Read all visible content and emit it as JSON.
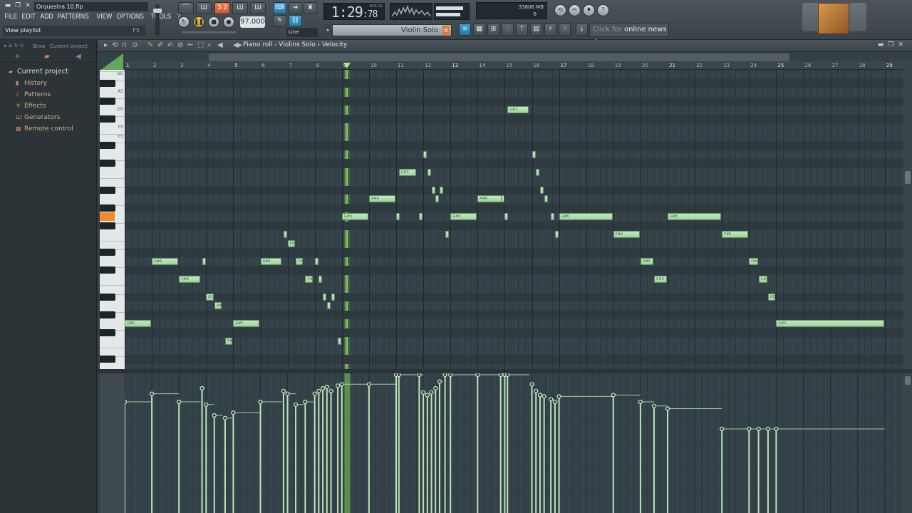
{
  "window": {
    "file_title": "Orquestra 10.flp",
    "menu": [
      "FILE",
      "EDIT",
      "ADD",
      "PATTERNS",
      "VIEW",
      "OPTIONS",
      "TOOLS",
      "?"
    ],
    "hint": "View playlist",
    "hint_key": "F5"
  },
  "transport": {
    "time_main": "1:29",
    "time_frac": ":78",
    "time_unit": "M:S:CS",
    "tempo": "97.000",
    "pattern_display": "3 2",
    "snap_mode": "Line",
    "memory": "33606 MB",
    "cpu": "6"
  },
  "channel": {
    "name": "Violin Solo",
    "number": "6"
  },
  "news": {
    "prefix": "Click for",
    "label": "online news"
  },
  "browser": {
    "label": "Brow",
    "sub": "Current project",
    "items": [
      {
        "label": "Current project",
        "icon": "folder-icon",
        "root": true
      },
      {
        "label": "History",
        "icon": "history-icon"
      },
      {
        "label": "Patterns",
        "icon": "pattern-icon"
      },
      {
        "label": "Effects",
        "icon": "effects-icon"
      },
      {
        "label": "Generators",
        "icon": "generator-icon"
      },
      {
        "label": "Remote control",
        "icon": "remote-icon"
      }
    ]
  },
  "piano_roll": {
    "breadcrumb": "Piano roll - Violins Solo › Velocity",
    "bars": [
      1,
      2,
      3,
      4,
      5,
      6,
      7,
      8,
      9,
      10,
      11,
      12,
      13,
      14,
      15,
      16,
      17,
      18,
      19,
      20,
      21,
      22,
      23,
      24,
      25,
      26,
      27,
      28,
      29
    ],
    "playhead_bar": 9.2,
    "highlighted_key": "G6",
    "key_labels": [
      "B7",
      "A7",
      "G7",
      "F7",
      "E7",
      "D7",
      "C7",
      "B6",
      "A6",
      "G6",
      "F6",
      "E6",
      "D6",
      "C6",
      "B5",
      "A5",
      "G5",
      "F5",
      "E5"
    ],
    "accent_color": "#9fd39e",
    "playhead_color": "#8ce65a"
  },
  "notes": [
    {
      "label": "G#5",
      "start": 1.0,
      "len": 1.0,
      "pitch": 55
    },
    {
      "label": "D#6",
      "start": 2.0,
      "len": 1.0,
      "pitch": 62
    },
    {
      "label": "C#6",
      "start": 3.0,
      "len": 0.8,
      "pitch": 60
    },
    {
      "label": "",
      "start": 3.85,
      "len": 0.1,
      "pitch": 62
    },
    {
      "label": "B5",
      "start": 4.0,
      "len": 0.3,
      "pitch": 58
    },
    {
      "label": "A#5",
      "start": 4.3,
      "len": 0.3,
      "pitch": 57
    },
    {
      "label": "F#5",
      "start": 4.7,
      "len": 0.3,
      "pitch": 53
    },
    {
      "label": "G#5",
      "start": 5.0,
      "len": 1.0,
      "pitch": 55
    },
    {
      "label": "D#6",
      "start": 6.0,
      "len": 0.8,
      "pitch": 62
    },
    {
      "label": "",
      "start": 6.85,
      "len": 0.1,
      "pitch": 65
    },
    {
      "label": "F6",
      "start": 7.0,
      "len": 0.3,
      "pitch": 64
    },
    {
      "label": "D#6",
      "start": 7.3,
      "len": 0.3,
      "pitch": 62
    },
    {
      "label": "C#6",
      "start": 7.65,
      "len": 0.3,
      "pitch": 60
    },
    {
      "label": "",
      "start": 8.0,
      "len": 0.1,
      "pitch": 62
    },
    {
      "label": "",
      "start": 8.15,
      "len": 0.1,
      "pitch": 60
    },
    {
      "label": "",
      "start": 8.3,
      "len": 0.1,
      "pitch": 58
    },
    {
      "label": "",
      "start": 8.45,
      "len": 0.1,
      "pitch": 57
    },
    {
      "label": "",
      "start": 8.6,
      "len": 0.1,
      "pitch": 58
    },
    {
      "label": "",
      "start": 8.85,
      "len": 0.1,
      "pitch": 53
    },
    {
      "label": "G#6",
      "start": 9.0,
      "len": 1.0,
      "pitch": 67
    },
    {
      "label": "A#6",
      "start": 10.0,
      "len": 1.0,
      "pitch": 69
    },
    {
      "label": "",
      "start": 11.0,
      "len": 0.15,
      "pitch": 67
    },
    {
      "label": "C#7",
      "start": 11.1,
      "len": 0.65,
      "pitch": 72
    },
    {
      "label": "",
      "start": 11.85,
      "len": 0.15,
      "pitch": 67
    },
    {
      "label": "",
      "start": 12.0,
      "len": 0.1,
      "pitch": 74
    },
    {
      "label": "",
      "start": 12.15,
      "len": 0.1,
      "pitch": 72
    },
    {
      "label": "",
      "start": 12.3,
      "len": 0.1,
      "pitch": 70
    },
    {
      "label": "",
      "start": 12.45,
      "len": 0.1,
      "pitch": 69
    },
    {
      "label": "",
      "start": 12.6,
      "len": 0.1,
      "pitch": 70
    },
    {
      "label": "",
      "start": 12.8,
      "len": 0.1,
      "pitch": 65
    },
    {
      "label": "G#6",
      "start": 13.0,
      "len": 1.0,
      "pitch": 67
    },
    {
      "label": "A#6",
      "start": 14.0,
      "len": 0.9,
      "pitch": 69
    },
    {
      "label": "",
      "start": 14.85,
      "len": 0.1,
      "pitch": 69
    },
    {
      "label": "",
      "start": 15.0,
      "len": 0.1,
      "pitch": 67
    },
    {
      "label": "G#7",
      "start": 15.1,
      "len": 0.8,
      "pitch": 79
    },
    {
      "label": "",
      "start": 16.0,
      "len": 0.1,
      "pitch": 74
    },
    {
      "label": "",
      "start": 16.15,
      "len": 0.1,
      "pitch": 72
    },
    {
      "label": "",
      "start": 16.3,
      "len": 0.1,
      "pitch": 70
    },
    {
      "label": "",
      "start": 16.45,
      "len": 0.1,
      "pitch": 69
    },
    {
      "label": "",
      "start": 16.7,
      "len": 0.1,
      "pitch": 67
    },
    {
      "label": "",
      "start": 16.85,
      "len": 0.1,
      "pitch": 65
    },
    {
      "label": "G#6",
      "start": 17.0,
      "len": 2.0,
      "pitch": 67
    },
    {
      "label": "F#6",
      "start": 19.0,
      "len": 1.0,
      "pitch": 65
    },
    {
      "label": "D#6",
      "start": 20.0,
      "len": 0.5,
      "pitch": 62
    },
    {
      "label": "C#6",
      "start": 20.5,
      "len": 0.5,
      "pitch": 60
    },
    {
      "label": "G#6",
      "start": 21.0,
      "len": 2.0,
      "pitch": 67
    },
    {
      "label": "F#6",
      "start": 23.0,
      "len": 1.0,
      "pitch": 65
    },
    {
      "label": "D#6",
      "start": 24.0,
      "len": 0.35,
      "pitch": 62
    },
    {
      "label": "C#6",
      "start": 24.35,
      "len": 0.35,
      "pitch": 60
    },
    {
      "label": "B5",
      "start": 24.7,
      "len": 0.3,
      "pitch": 58
    },
    {
      "label": "G#5",
      "start": 25.0,
      "len": 4.0,
      "pitch": 55
    }
  ],
  "velocity": [
    {
      "start": 1.0,
      "v": 0.8
    },
    {
      "start": 2.0,
      "v": 0.86
    },
    {
      "start": 3.0,
      "v": 0.8
    },
    {
      "start": 3.85,
      "v": 0.9
    },
    {
      "start": 4.0,
      "v": 0.78
    },
    {
      "start": 4.3,
      "v": 0.7
    },
    {
      "start": 4.7,
      "v": 0.68
    },
    {
      "start": 5.0,
      "v": 0.72
    },
    {
      "start": 6.0,
      "v": 0.8
    },
    {
      "start": 6.85,
      "v": 0.88
    },
    {
      "start": 7.0,
      "v": 0.86
    },
    {
      "start": 7.3,
      "v": 0.78
    },
    {
      "start": 7.65,
      "v": 0.8
    },
    {
      "start": 8.0,
      "v": 0.86
    },
    {
      "start": 8.15,
      "v": 0.88
    },
    {
      "start": 8.3,
      "v": 0.9
    },
    {
      "start": 8.45,
      "v": 0.91
    },
    {
      "start": 8.6,
      "v": 0.88
    },
    {
      "start": 8.85,
      "v": 0.92
    },
    {
      "start": 9.0,
      "v": 0.93
    },
    {
      "start": 10.0,
      "v": 0.93
    },
    {
      "start": 11.0,
      "v": 1.0
    },
    {
      "start": 11.1,
      "v": 1.0
    },
    {
      "start": 11.85,
      "v": 1.0
    },
    {
      "start": 12.0,
      "v": 0.87
    },
    {
      "start": 12.15,
      "v": 0.85
    },
    {
      "start": 12.3,
      "v": 0.87
    },
    {
      "start": 12.45,
      "v": 0.9
    },
    {
      "start": 12.6,
      "v": 0.95
    },
    {
      "start": 12.8,
      "v": 1.0
    },
    {
      "start": 13.0,
      "v": 1.0
    },
    {
      "start": 14.0,
      "v": 1.0
    },
    {
      "start": 14.85,
      "v": 1.0
    },
    {
      "start": 15.0,
      "v": 1.0
    },
    {
      "start": 15.1,
      "v": 1.0
    },
    {
      "start": 16.0,
      "v": 0.93
    },
    {
      "start": 16.15,
      "v": 0.88
    },
    {
      "start": 16.3,
      "v": 0.85
    },
    {
      "start": 16.45,
      "v": 0.84
    },
    {
      "start": 16.7,
      "v": 0.82
    },
    {
      "start": 16.85,
      "v": 0.8
    },
    {
      "start": 17.0,
      "v": 0.84
    },
    {
      "start": 19.0,
      "v": 0.85
    },
    {
      "start": 20.0,
      "v": 0.8
    },
    {
      "start": 20.5,
      "v": 0.77
    },
    {
      "start": 21.0,
      "v": 0.75
    },
    {
      "start": 23.0,
      "v": 0.6
    },
    {
      "start": 24.0,
      "v": 0.6
    },
    {
      "start": 24.35,
      "v": 0.6
    },
    {
      "start": 24.7,
      "v": 0.6
    },
    {
      "start": 25.0,
      "v": 0.6
    }
  ]
}
